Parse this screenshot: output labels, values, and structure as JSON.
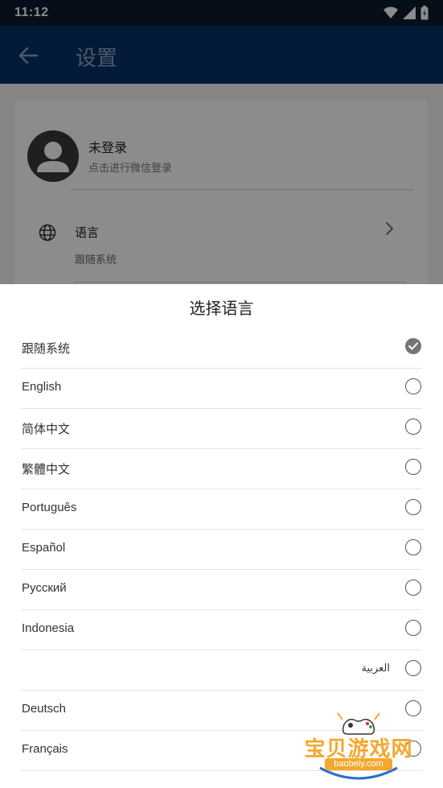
{
  "status_bar": {
    "time": "11:12"
  },
  "app_bar": {
    "title": "设置",
    "back_icon": "arrow-left-icon"
  },
  "profile": {
    "name": "未登录",
    "subtitle": "点击进行微信登录"
  },
  "language_setting": {
    "title": "语言",
    "value": "跟随系统",
    "icon": "globe-icon"
  },
  "sheet": {
    "title": "选择语言",
    "options": [
      {
        "label": "跟随系统",
        "selected": true
      },
      {
        "label": "English",
        "selected": false
      },
      {
        "label": "简体中文",
        "selected": false
      },
      {
        "label": "繁體中文",
        "selected": false
      },
      {
        "label": "Português",
        "selected": false
      },
      {
        "label": "Español",
        "selected": false
      },
      {
        "label": "Русский",
        "selected": false
      },
      {
        "label": "Indonesia",
        "selected": false
      },
      {
        "label": "العربية",
        "selected": false
      },
      {
        "label": "Deutsch",
        "selected": false
      },
      {
        "label": "Français",
        "selected": false
      }
    ]
  },
  "watermark": {
    "text": "宝贝游戏网",
    "url": "baobeiy.com"
  },
  "colors": {
    "status_bar": "#0a1b2f",
    "app_bar": "#073066",
    "accent_orange": "#f3a82e",
    "radio_checked": "#757575"
  }
}
